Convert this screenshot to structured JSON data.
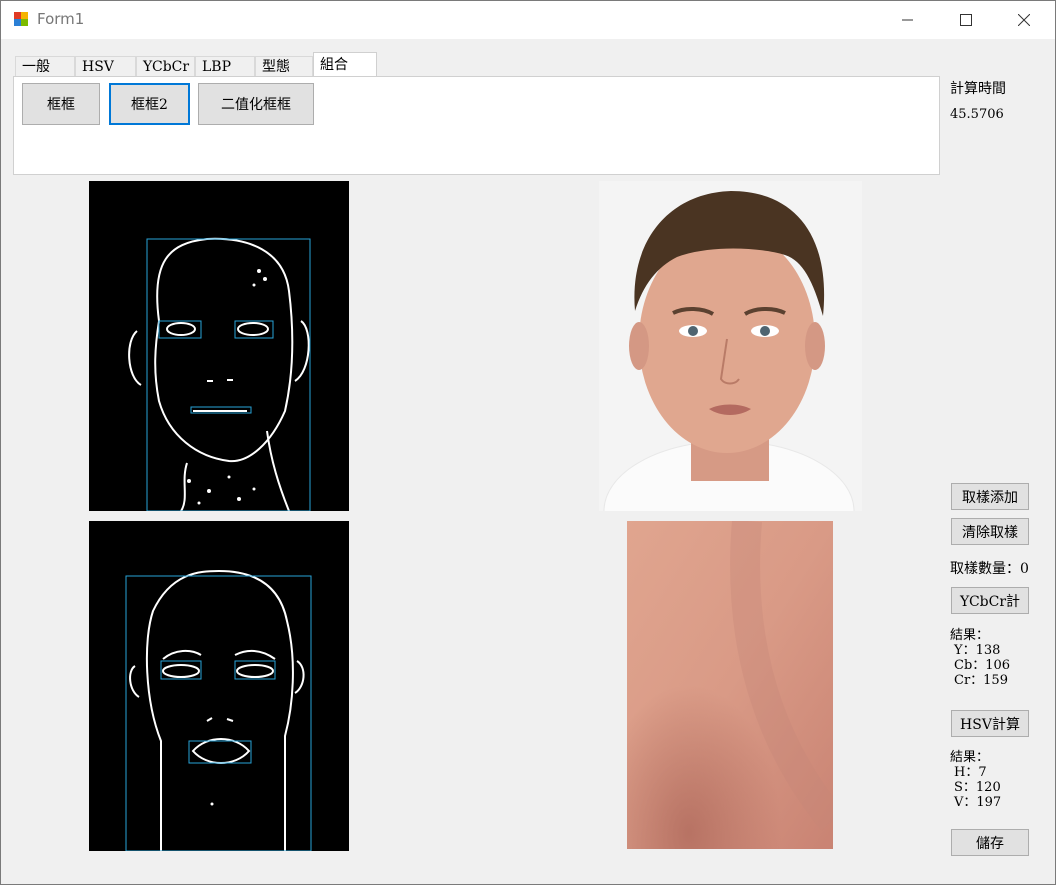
{
  "window": {
    "title": "Form1",
    "minimize_glyph": "—",
    "maximize_glyph": "☐",
    "close_glyph": "✕"
  },
  "tabs": [
    {
      "label": "一般",
      "active": false
    },
    {
      "label": "HSV",
      "active": false
    },
    {
      "label": "YCbCr",
      "active": false
    },
    {
      "label": "LBP",
      "active": false
    },
    {
      "label": "型態",
      "active": false
    },
    {
      "label": "組合",
      "active": true
    }
  ],
  "toolbar": {
    "kuangkuang": "框框",
    "kuangkuang2": "框框2",
    "binary_kuangkuang": "二值化框框"
  },
  "timing": {
    "label": "計算時間",
    "value": "45.5706"
  },
  "side": {
    "add_sample": "取樣添加",
    "clear_sample": "清除取樣",
    "sample_count": "取樣數量：0",
    "ycbcr_calc": "YCbCr計",
    "ycbcr_result_title": "結果：",
    "ycbcr_y": "Y：138",
    "ycbcr_cb": "Cb：106",
    "ycbcr_cr": "Cr：159",
    "hsv_calc": "HSV計算",
    "hsv_result_title": "結果：",
    "hsv_h": "H：7",
    "hsv_s": "S：120",
    "hsv_v": "V：197",
    "save": "儲存"
  },
  "colors": {
    "accent": "#0078d7",
    "box_line": "#29a3d8",
    "skin": "#d99a86"
  }
}
